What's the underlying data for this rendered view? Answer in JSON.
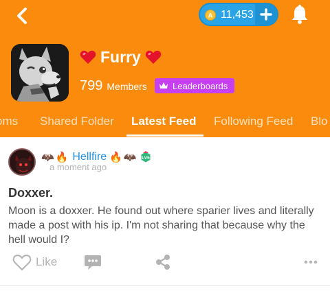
{
  "header": {
    "coins": "11,453",
    "community_name": "Furry",
    "members_count": "799",
    "members_label": "Members",
    "leaderboards_label": "Leaderboards"
  },
  "tabs": [
    {
      "label": "oms"
    },
    {
      "label": "Shared Folder"
    },
    {
      "label": "Latest Feed",
      "active": true
    },
    {
      "label": "Following Feed"
    },
    {
      "label": "Blo"
    }
  ],
  "post": {
    "author": "Hellfire",
    "level_badge": "LV5",
    "time": "a moment ago",
    "title": "Doxxer.",
    "body": "Moon is a doxxer. He found out where sparier lives and literally made a post with his ip. I'm not sharing that because why the hell would I?",
    "like_label": "Like"
  },
  "colors": {
    "header_bg": "#fb8b0c",
    "coin_pill": "#2aa4e6",
    "leaderboard_bg": "#c63ff0",
    "author_link": "#1f8fe0"
  },
  "icons": [
    "back-chevron-icon",
    "coin-icon",
    "plus-icon",
    "bell-icon",
    "heart-icon",
    "crown-icon",
    "bat-icon",
    "fire-icon",
    "level-badge-icon",
    "like-heart-icon",
    "comment-icon",
    "share-icon",
    "more-icon"
  ]
}
